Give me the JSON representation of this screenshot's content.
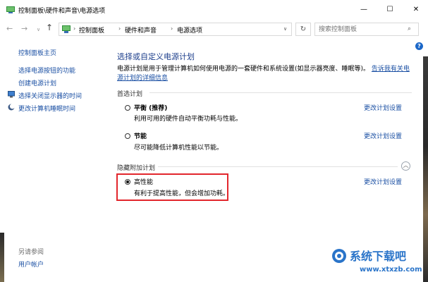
{
  "window": {
    "title": "控制面板\\硬件和声音\\电源选项",
    "minimize": "—",
    "maximize": "☐",
    "close": "✕"
  },
  "nav": {
    "back": "←",
    "forward": "→",
    "dropdown": "∨",
    "up": "↑",
    "breadcrumbs": [
      "控制面板",
      "硬件和声音",
      "电源选项"
    ],
    "separator": "›",
    "refresh": "↻",
    "search_placeholder": "搜索控制面板",
    "search_icon": "⌕"
  },
  "sidebar": {
    "items": [
      {
        "label": "控制面板主页",
        "icon": ""
      },
      {
        "label": "选择电源按钮的功能",
        "icon": ""
      },
      {
        "label": "创建电源计划",
        "icon": ""
      },
      {
        "label": "选择关闭显示器的时间",
        "icon": "monitor-icon"
      },
      {
        "label": "更改计算机睡眠时间",
        "icon": "moon-icon"
      }
    ],
    "see_also_label": "另请参阅",
    "see_also_items": [
      "用户帐户"
    ]
  },
  "main": {
    "help": "?",
    "title": "选择或自定义电源计划",
    "description_text": "电源计划是用于管理计算机如何使用电源的一套硬件和系统设置(如显示器亮度、睡眠等)。",
    "description_link": "告诉我有关电源计划的详细信息",
    "preferred_label": "首选计划",
    "hidden_label": "隐藏附加计划",
    "collapse_icon": "︿",
    "plans": [
      {
        "name": "平衡 (推荐)",
        "desc": "利用可用的硬件自动平衡功耗与性能。",
        "link": "更改计划设置",
        "selected": false
      },
      {
        "name": "节能",
        "desc": "尽可能降低计算机性能以节能。",
        "link": "更改计划设置",
        "selected": false
      },
      {
        "name": "高性能",
        "desc": "有利于提高性能，但会增加功耗。",
        "link": "更改计划设置",
        "selected": true
      }
    ]
  },
  "watermark": {
    "title": "系统下载吧",
    "url": "www.xtxzb.com"
  },
  "colors": {
    "link": "#1a4fa3",
    "title": "#1c3e8c",
    "highlight_border": "#e2262c",
    "watermark": "#2a74c9"
  }
}
